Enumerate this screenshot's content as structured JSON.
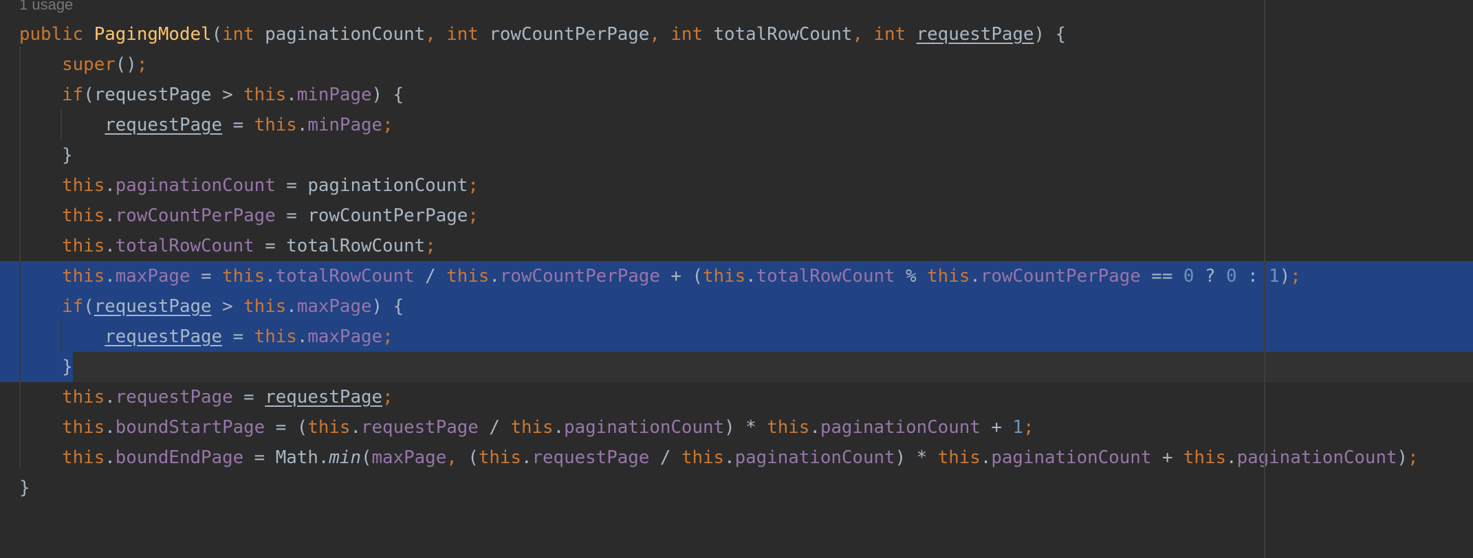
{
  "editor": {
    "usage_hint": "1 usage",
    "colors": {
      "background": "#2b2b2b",
      "selection": "#214283",
      "keyword": "#cc7832",
      "method_declaration": "#ffc66d",
      "field": "#9876aa",
      "number": "#6897bb",
      "plain": "#a9b7c6",
      "usage_hint": "#787878"
    },
    "selection": {
      "first_line": 9,
      "last_line": 12,
      "partial_end_text": "}"
    },
    "lines": [
      {
        "n": 1,
        "tokens": [
          {
            "t": "public ",
            "c": "kw"
          },
          {
            "t": "PagingModel",
            "c": "fn"
          },
          {
            "t": "(",
            "c": "p"
          },
          {
            "t": "int ",
            "c": "kw"
          },
          {
            "t": "paginationCount",
            "c": "id"
          },
          {
            "t": ", ",
            "c": "kw"
          },
          {
            "t": "int ",
            "c": "kw"
          },
          {
            "t": "rowCountPerPage",
            "c": "id"
          },
          {
            "t": ", ",
            "c": "kw"
          },
          {
            "t": "int ",
            "c": "kw"
          },
          {
            "t": "totalRowCount",
            "c": "id"
          },
          {
            "t": ", ",
            "c": "kw"
          },
          {
            "t": "int ",
            "c": "kw"
          },
          {
            "t": "requestPage",
            "c": "id u"
          },
          {
            "t": ") {",
            "c": "p"
          }
        ]
      },
      {
        "n": 2,
        "tokens": [
          {
            "t": "    ",
            "c": "p"
          },
          {
            "t": "super",
            "c": "kw"
          },
          {
            "t": "()",
            "c": "p"
          },
          {
            "t": ";",
            "c": "kw"
          }
        ]
      },
      {
        "n": 3,
        "tokens": [
          {
            "t": "    ",
            "c": "p"
          },
          {
            "t": "if",
            "c": "kw"
          },
          {
            "t": "(requestPage > ",
            "c": "p"
          },
          {
            "t": "this",
            "c": "kw"
          },
          {
            "t": ".",
            "c": "p"
          },
          {
            "t": "minPage",
            "c": "fld"
          },
          {
            "t": ") {",
            "c": "p"
          }
        ]
      },
      {
        "n": 4,
        "tokens": [
          {
            "t": "        ",
            "c": "p"
          },
          {
            "t": "requestPage",
            "c": "id u"
          },
          {
            "t": " = ",
            "c": "p"
          },
          {
            "t": "this",
            "c": "kw"
          },
          {
            "t": ".",
            "c": "p"
          },
          {
            "t": "minPage",
            "c": "fld"
          },
          {
            "t": ";",
            "c": "kw"
          }
        ]
      },
      {
        "n": 5,
        "tokens": [
          {
            "t": "    }",
            "c": "p"
          }
        ]
      },
      {
        "n": 6,
        "tokens": [
          {
            "t": "    ",
            "c": "p"
          },
          {
            "t": "this",
            "c": "kw"
          },
          {
            "t": ".",
            "c": "p"
          },
          {
            "t": "paginationCount",
            "c": "fld"
          },
          {
            "t": " = paginationCount",
            "c": "p"
          },
          {
            "t": ";",
            "c": "kw"
          }
        ]
      },
      {
        "n": 7,
        "tokens": [
          {
            "t": "    ",
            "c": "p"
          },
          {
            "t": "this",
            "c": "kw"
          },
          {
            "t": ".",
            "c": "p"
          },
          {
            "t": "rowCountPerPage",
            "c": "fld"
          },
          {
            "t": " = rowCountPerPage",
            "c": "p"
          },
          {
            "t": ";",
            "c": "kw"
          }
        ]
      },
      {
        "n": 8,
        "tokens": [
          {
            "t": "    ",
            "c": "p"
          },
          {
            "t": "this",
            "c": "kw"
          },
          {
            "t": ".",
            "c": "p"
          },
          {
            "t": "totalRowCount",
            "c": "fld"
          },
          {
            "t": " = totalRowCount",
            "c": "p"
          },
          {
            "t": ";",
            "c": "kw"
          }
        ]
      },
      {
        "n": 9,
        "tokens": [
          {
            "t": "    ",
            "c": "p"
          },
          {
            "t": "this",
            "c": "kw"
          },
          {
            "t": ".",
            "c": "p"
          },
          {
            "t": "maxPage",
            "c": "fld"
          },
          {
            "t": " = ",
            "c": "p"
          },
          {
            "t": "this",
            "c": "kw"
          },
          {
            "t": ".",
            "c": "p"
          },
          {
            "t": "totalRowCount",
            "c": "fld"
          },
          {
            "t": " / ",
            "c": "p"
          },
          {
            "t": "this",
            "c": "kw"
          },
          {
            "t": ".",
            "c": "p"
          },
          {
            "t": "rowCountPerPage",
            "c": "fld"
          },
          {
            "t": " + (",
            "c": "p"
          },
          {
            "t": "this",
            "c": "kw"
          },
          {
            "t": ".",
            "c": "p"
          },
          {
            "t": "totalRowCount",
            "c": "fld"
          },
          {
            "t": " % ",
            "c": "p"
          },
          {
            "t": "this",
            "c": "kw"
          },
          {
            "t": ".",
            "c": "p"
          },
          {
            "t": "rowCountPerPage",
            "c": "fld"
          },
          {
            "t": " == ",
            "c": "p"
          },
          {
            "t": "0",
            "c": "num"
          },
          {
            "t": " ? ",
            "c": "p"
          },
          {
            "t": "0",
            "c": "num"
          },
          {
            "t": " : ",
            "c": "p"
          },
          {
            "t": "1",
            "c": "num"
          },
          {
            "t": ")",
            "c": "p"
          },
          {
            "t": ";",
            "c": "kw"
          }
        ]
      },
      {
        "n": 10,
        "tokens": [
          {
            "t": "    ",
            "c": "p"
          },
          {
            "t": "if",
            "c": "kw"
          },
          {
            "t": "(",
            "c": "p"
          },
          {
            "t": "requestPage",
            "c": "id u"
          },
          {
            "t": " > ",
            "c": "p"
          },
          {
            "t": "this",
            "c": "kw"
          },
          {
            "t": ".",
            "c": "p"
          },
          {
            "t": "maxPage",
            "c": "fld"
          },
          {
            "t": ") {",
            "c": "p"
          }
        ]
      },
      {
        "n": 11,
        "tokens": [
          {
            "t": "        ",
            "c": "p"
          },
          {
            "t": "requestPage",
            "c": "id u"
          },
          {
            "t": " = ",
            "c": "p"
          },
          {
            "t": "this",
            "c": "kw"
          },
          {
            "t": ".",
            "c": "p"
          },
          {
            "t": "maxPage",
            "c": "fld"
          },
          {
            "t": ";",
            "c": "kw"
          }
        ]
      },
      {
        "n": 12,
        "tokens": [
          {
            "t": "    }",
            "c": "p"
          }
        ]
      },
      {
        "n": 13,
        "tokens": [
          {
            "t": "    ",
            "c": "p"
          },
          {
            "t": "this",
            "c": "kw"
          },
          {
            "t": ".",
            "c": "p"
          },
          {
            "t": "requestPage",
            "c": "fld"
          },
          {
            "t": " = ",
            "c": "p"
          },
          {
            "t": "requestPage",
            "c": "id u"
          },
          {
            "t": ";",
            "c": "kw"
          }
        ]
      },
      {
        "n": 14,
        "tokens": [
          {
            "t": "    ",
            "c": "p"
          },
          {
            "t": "this",
            "c": "kw"
          },
          {
            "t": ".",
            "c": "p"
          },
          {
            "t": "boundStartPage",
            "c": "fld"
          },
          {
            "t": " = (",
            "c": "p"
          },
          {
            "t": "this",
            "c": "kw"
          },
          {
            "t": ".",
            "c": "p"
          },
          {
            "t": "requestPage",
            "c": "fld"
          },
          {
            "t": " / ",
            "c": "p"
          },
          {
            "t": "this",
            "c": "kw"
          },
          {
            "t": ".",
            "c": "p"
          },
          {
            "t": "paginationCount",
            "c": "fld"
          },
          {
            "t": ") * ",
            "c": "p"
          },
          {
            "t": "this",
            "c": "kw"
          },
          {
            "t": ".",
            "c": "p"
          },
          {
            "t": "paginationCount",
            "c": "fld"
          },
          {
            "t": " + ",
            "c": "p"
          },
          {
            "t": "1",
            "c": "num"
          },
          {
            "t": ";",
            "c": "kw"
          }
        ]
      },
      {
        "n": 15,
        "tokens": [
          {
            "t": "    ",
            "c": "p"
          },
          {
            "t": "this",
            "c": "kw"
          },
          {
            "t": ".",
            "c": "p"
          },
          {
            "t": "boundEndPage",
            "c": "fld"
          },
          {
            "t": " = Math.",
            "c": "p"
          },
          {
            "t": "min",
            "c": "id it"
          },
          {
            "t": "(",
            "c": "p"
          },
          {
            "t": "maxPage",
            "c": "fld"
          },
          {
            "t": ", ",
            "c": "kw"
          },
          {
            "t": "(",
            "c": "p"
          },
          {
            "t": "this",
            "c": "kw"
          },
          {
            "t": ".",
            "c": "p"
          },
          {
            "t": "requestPage",
            "c": "fld"
          },
          {
            "t": " / ",
            "c": "p"
          },
          {
            "t": "this",
            "c": "kw"
          },
          {
            "t": ".",
            "c": "p"
          },
          {
            "t": "paginationCount",
            "c": "fld"
          },
          {
            "t": ") * ",
            "c": "p"
          },
          {
            "t": "this",
            "c": "kw"
          },
          {
            "t": ".",
            "c": "p"
          },
          {
            "t": "paginationCount",
            "c": "fld"
          },
          {
            "t": " + ",
            "c": "p"
          },
          {
            "t": "this",
            "c": "kw"
          },
          {
            "t": ".",
            "c": "p"
          },
          {
            "t": "paginationCount",
            "c": "fld"
          },
          {
            "t": ")",
            "c": "p"
          },
          {
            "t": ";",
            "c": "kw"
          }
        ]
      },
      {
        "n": 16,
        "tokens": [
          {
            "t": "}",
            "c": "p"
          }
        ]
      }
    ]
  }
}
